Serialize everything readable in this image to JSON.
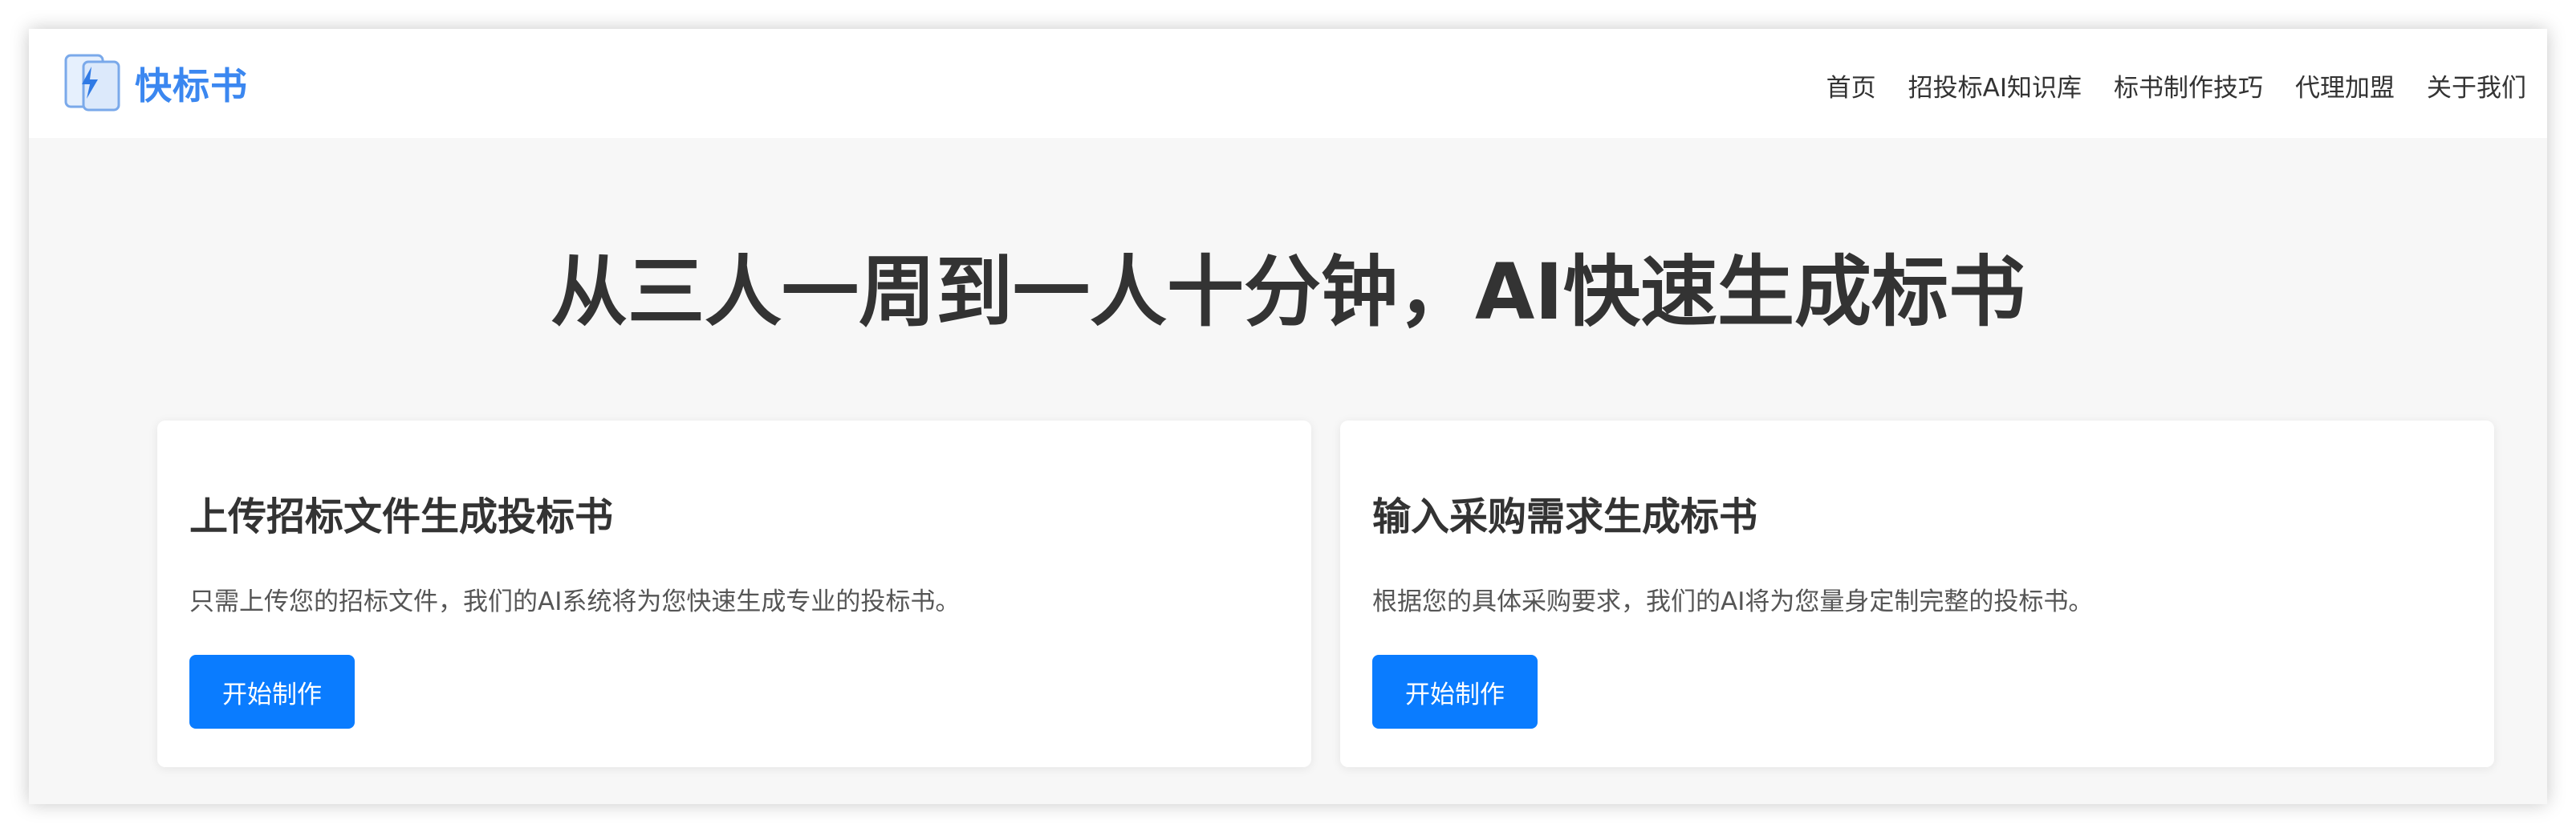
{
  "brand": {
    "name": "快标书",
    "icon": "document-lightning-icon",
    "color": "#3b87f0"
  },
  "nav": {
    "items": [
      {
        "label": "首页"
      },
      {
        "label": "招投标AI知识库"
      },
      {
        "label": "标书制作技巧"
      },
      {
        "label": "代理加盟"
      },
      {
        "label": "关于我们"
      }
    ]
  },
  "hero": {
    "title": "从三人一周到一人十分钟，AI快速生成标书"
  },
  "cards": [
    {
      "title": "上传招标文件生成投标书",
      "description": "只需上传您的招标文件，我们的AI系统将为您快速生成专业的投标书。",
      "button_label": "开始制作"
    },
    {
      "title": "输入采购需求生成标书",
      "description": "根据您的具体采购要求，我们的AI将为您量身定制完整的投标书。",
      "button_label": "开始制作"
    }
  ],
  "colors": {
    "primary_button": "#0a7cff",
    "background": "#f7f7f7",
    "text": "#333333"
  }
}
